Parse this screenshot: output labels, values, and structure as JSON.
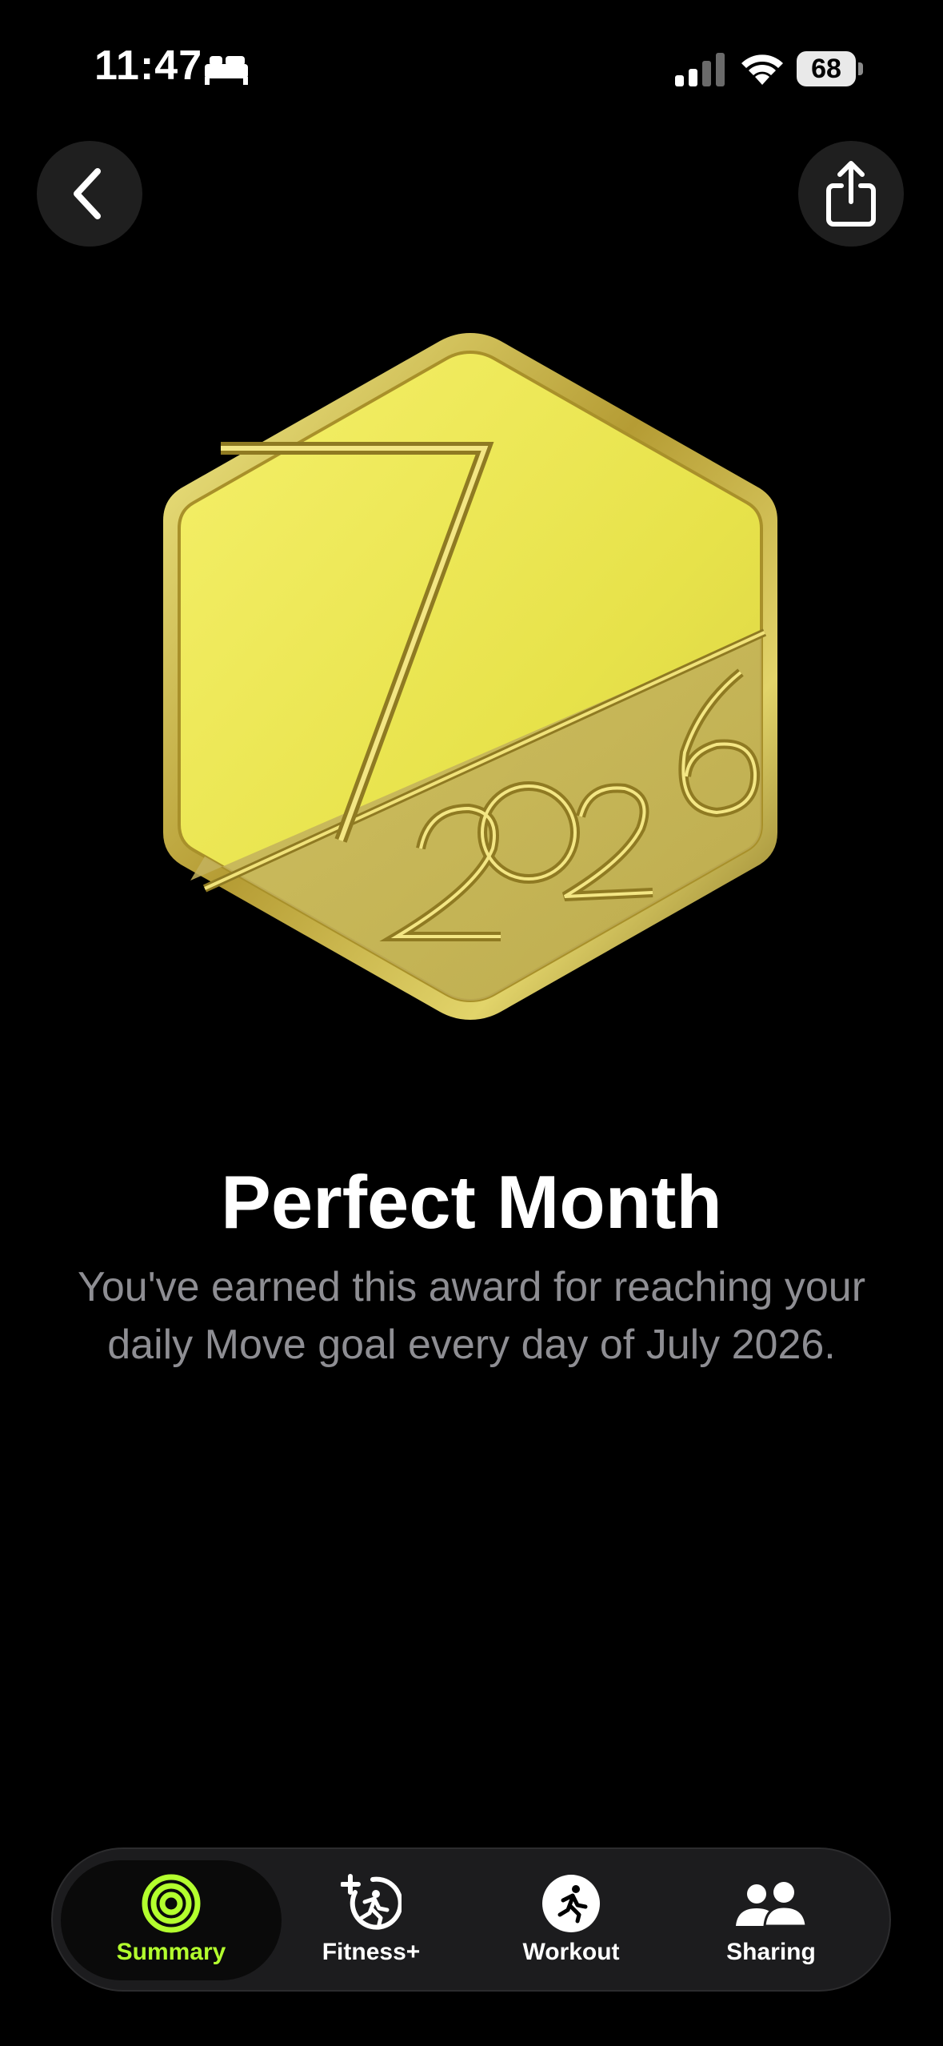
{
  "status_bar": {
    "time": "11:47",
    "battery": "68"
  },
  "award": {
    "title": "Perfect Month",
    "description": "You've earned this award for reaching your daily Move goal every day of July 2026.",
    "badge_month": "7",
    "badge_year": "2026",
    "colors": {
      "badge": "#e6e34a",
      "rim": "#b8a338"
    }
  },
  "tabs": [
    {
      "label": "Summary",
      "icon": "activity-rings-icon",
      "active": true
    },
    {
      "label": "Fitness+",
      "icon": "fitness-plus-icon",
      "active": false
    },
    {
      "label": "Workout",
      "icon": "workout-runner-icon",
      "active": false
    },
    {
      "label": "Sharing",
      "icon": "sharing-people-icon",
      "active": false
    }
  ],
  "colors": {
    "accent": "#b3ff2e",
    "background": "#000000",
    "secondary_text": "#8e8e93"
  }
}
